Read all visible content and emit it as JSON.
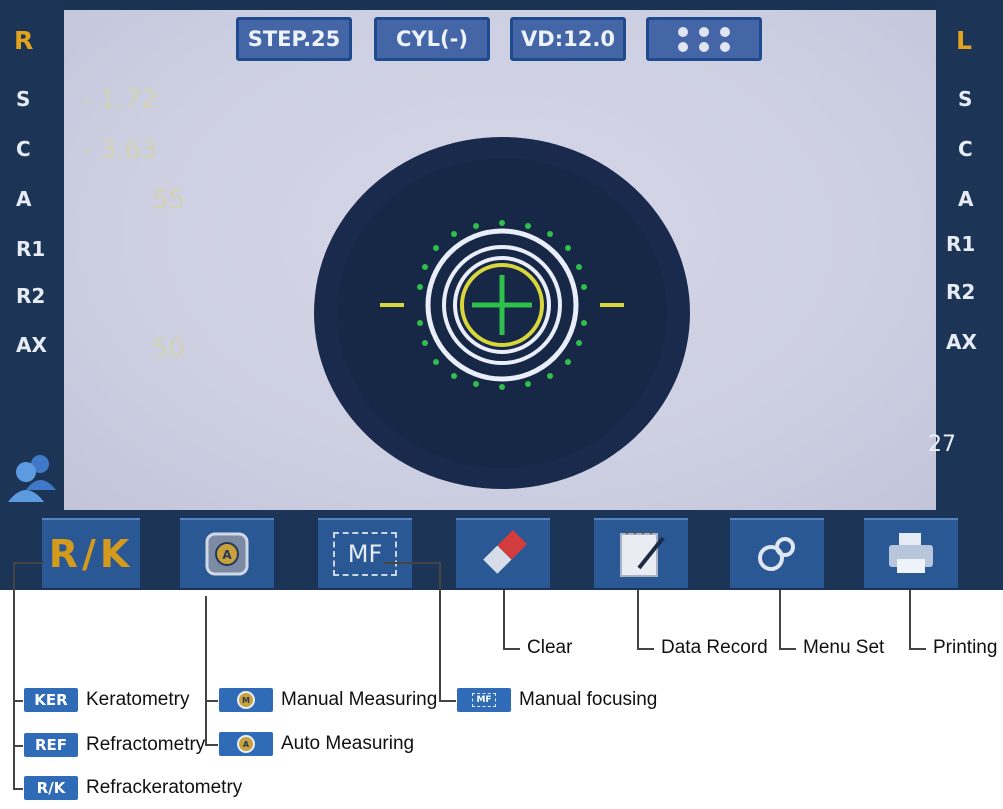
{
  "left_panel": {
    "eye": "R",
    "labels": [
      "S",
      "C",
      "A",
      "R1",
      "R2",
      "AX"
    ],
    "values": {
      "s": "- 1.72",
      "c": "- 3.63",
      "a": "55",
      "ax": "50"
    }
  },
  "right_panel": {
    "eye": "L",
    "labels": [
      "S",
      "C",
      "A",
      "R1",
      "R2",
      "AX"
    ],
    "counter": "27"
  },
  "top_bar": {
    "step": "STEP.25",
    "cyl": "CYL(-)",
    "vd": "VD:12.0"
  },
  "toolbar": {
    "rk_label": "R/K",
    "auto_icon_letter": "A",
    "mf_label": "MF"
  },
  "annotations": {
    "clear": "Clear",
    "data_record": "Data Record",
    "menu_set": "Menu Set",
    "printing": "Printing",
    "keratometry_badge": "KER",
    "keratometry": "Keratometry",
    "refractometry_badge": "REF",
    "refractometry": "Refractometry",
    "rk_badge": "R/K",
    "refrackeratometry": "Refrackeratometry",
    "manual_measuring_icon": "M",
    "manual_measuring": "Manual Measuring",
    "auto_measuring_icon": "A",
    "auto_measuring": "Auto Measuring",
    "manual_focusing_icon": "MF",
    "manual_focusing": "Manual focusing"
  },
  "colors": {
    "frame": "#1c3556",
    "accent_orange": "#e3a21c",
    "target_green": "#2ec04a",
    "target_yellow": "#d8d63a"
  }
}
